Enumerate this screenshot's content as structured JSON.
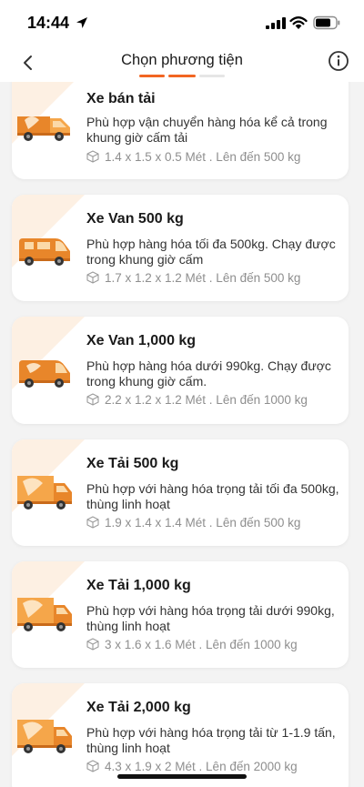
{
  "status": {
    "time": "14:44"
  },
  "header": {
    "title": "Chọn phương tiện"
  },
  "colors": {
    "accent": "#f26522",
    "deco": "#fdf0e3",
    "steps": [
      "#f26522",
      "#f26522",
      "#e6e6e6"
    ]
  },
  "icons": {
    "back": "chevron-left-icon",
    "info": "info-icon",
    "dimensions": "box-icon",
    "location": "location-arrow-icon"
  },
  "vehicles": [
    {
      "name": "Xe bán tải",
      "desc": "Phù hợp vận chuyển hàng hóa kể cả trong khung giờ cấm tải",
      "spec": "1.4 x 1.5 x 0.5 Mét . Lên đến 500 kg"
    },
    {
      "name": "Xe Van 500 kg",
      "desc": "Phù hợp hàng hóa tối đa 500kg. Chạy được trong khung giờ cấm",
      "spec": "1.7 x 1.2 x 1.2 Mét . Lên đến 500 kg"
    },
    {
      "name": "Xe Van 1,000 kg",
      "desc": "Phù hợp hàng hóa dưới 990kg. Chạy được trong khung giờ cấm.",
      "spec": "2.2 x 1.2 x 1.2 Mét . Lên đến 1000 kg"
    },
    {
      "name": "Xe Tải 500 kg",
      "desc": "Phù hợp với hàng hóa trọng tải tối đa 500kg, thùng linh hoạt",
      "spec": "1.9 x 1.4 x 1.4 Mét . Lên đến 500 kg"
    },
    {
      "name": "Xe Tải 1,000 kg",
      "desc": "Phù hợp với hàng hóa trọng tải dưới 990kg, thùng linh hoạt",
      "spec": "3 x 1.6 x 1.6 Mét . Lên đến 1000 kg"
    },
    {
      "name": "Xe Tải 2,000 kg",
      "desc": "Phù hợp với hàng hóa trọng tải từ 1-1.9 tấn, thùng linh hoạt",
      "spec": "4.3 x 1.9 x 2 Mét . Lên đến 2000 kg"
    }
  ]
}
